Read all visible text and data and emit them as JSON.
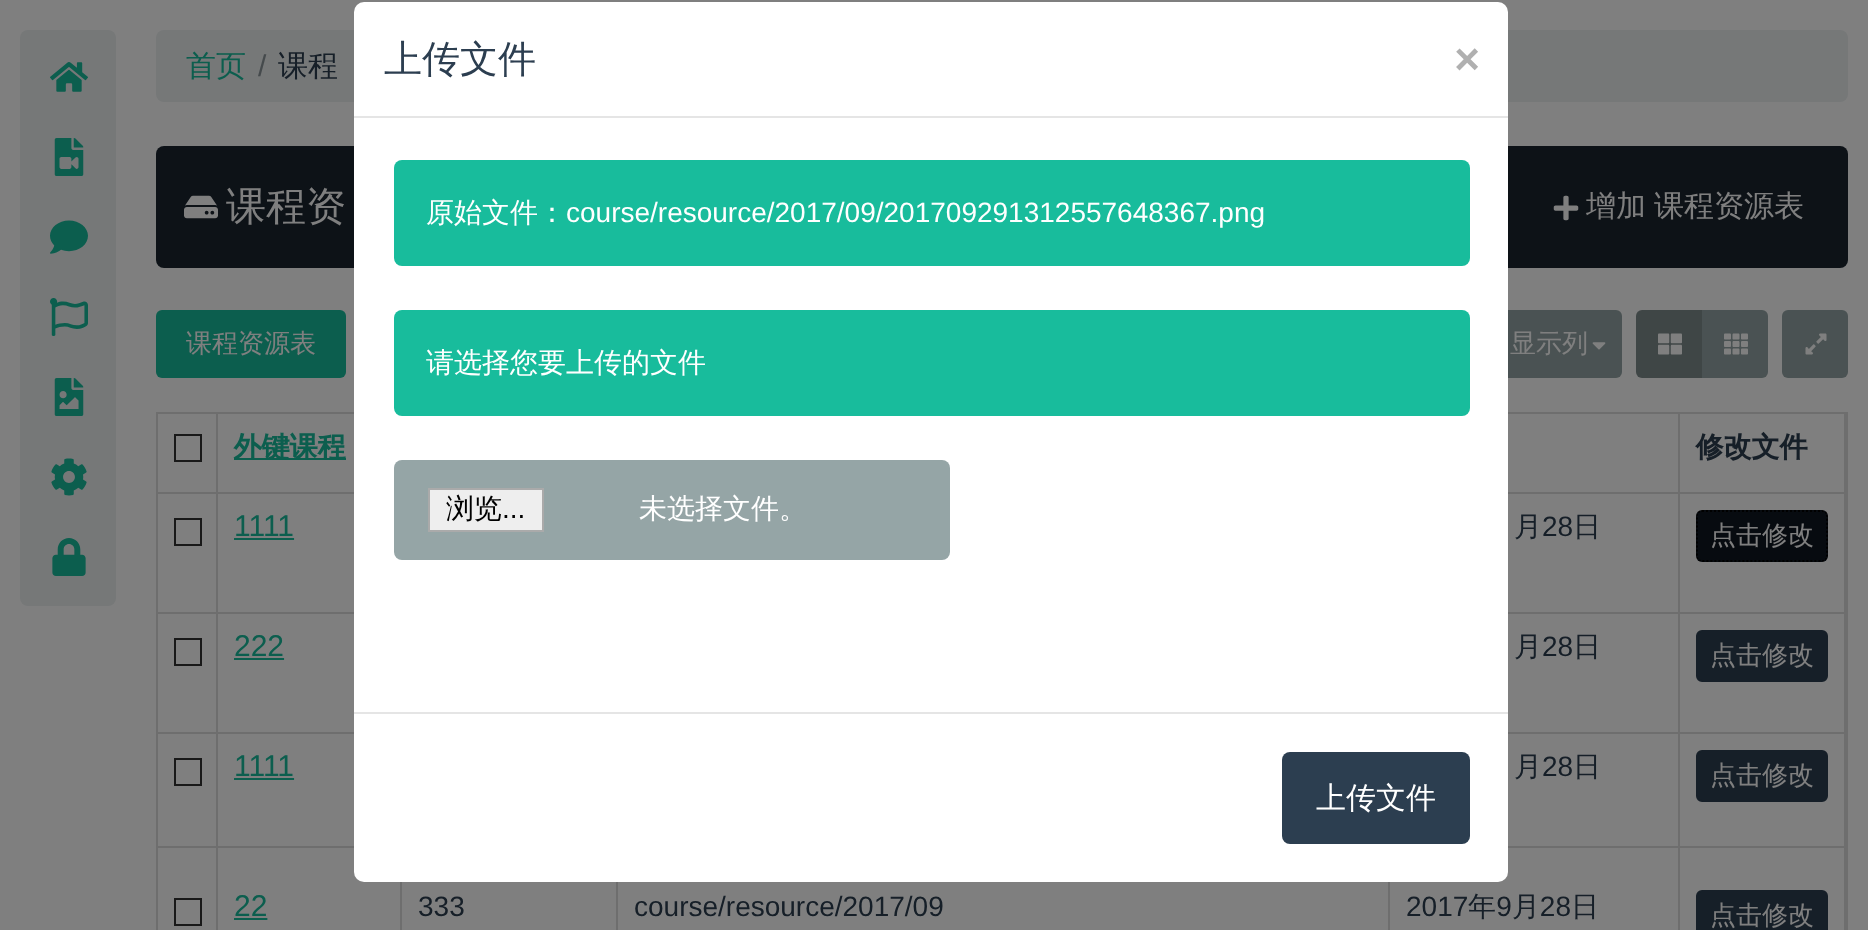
{
  "sidebar": {
    "items": [
      {
        "kind": "home"
      },
      {
        "kind": "video"
      },
      {
        "kind": "comment"
      },
      {
        "kind": "flag"
      },
      {
        "kind": "image"
      },
      {
        "kind": "settings"
      },
      {
        "kind": "lock"
      }
    ]
  },
  "breadcrumb_separator": "/",
  "breadcrumb": [
    {
      "label": "首页",
      "kind": "link"
    },
    {
      "label": "课程",
      "kind": "current"
    }
  ],
  "header": {
    "title": "课程资",
    "add_button": "增加 课程资源表"
  },
  "toolbar": {
    "table_button": "课程资源表",
    "columns_dropdown": "显示列",
    "views": [
      {
        "kind": "large",
        "selected": true
      },
      {
        "kind": "small",
        "selected": false
      }
    ]
  },
  "table": {
    "header_checked": false,
    "columns": [
      "外键课程",
      "修改文件"
    ],
    "rows": [
      {
        "checked": false,
        "column_2": "1111",
        "date": "月28日",
        "edit": "点击修改",
        "focused": true
      },
      {
        "checked": false,
        "column_2": "222",
        "date": "月28日",
        "edit": "点击修改",
        "focused": false
      },
      {
        "checked": false,
        "column_2": "1111",
        "date": "月28日",
        "edit": "点击修改",
        "focused": false
      },
      {
        "checked": false,
        "column_2": "22",
        "column_3": "333",
        "path": "course/resource/2017/09",
        "date": "2017年9月28日",
        "edit": "点击修改",
        "focused": false
      }
    ]
  },
  "modal": {
    "title": "上传文件",
    "close": "×",
    "original_file": "原始文件：course/resource/2017/09/201709291312557648367.png",
    "prompt": "请选择您要上传的文件",
    "browse_button": "浏览...",
    "no_file": "未选择文件。",
    "submit": "上传文件"
  }
}
